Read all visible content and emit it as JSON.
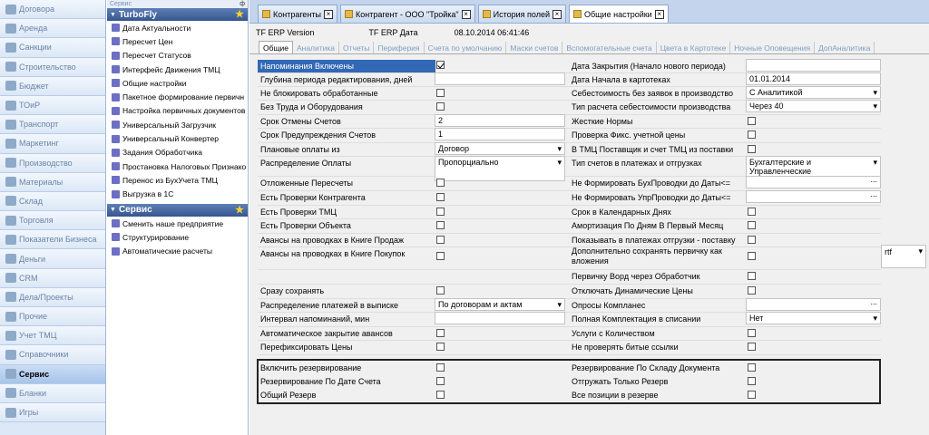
{
  "left_nav": {
    "items": [
      {
        "label": "Договора",
        "icon": "contract-icon",
        "active": false
      },
      {
        "label": "Аренда",
        "icon": "rent-icon",
        "active": false
      },
      {
        "label": "Санкции",
        "icon": "sanctions-icon",
        "active": false
      },
      {
        "label": "Строительство",
        "icon": "construction-icon",
        "active": false
      },
      {
        "label": "Бюджет",
        "icon": "budget-icon",
        "active": false
      },
      {
        "label": "ТОиР",
        "icon": "maintenance-icon",
        "active": false
      },
      {
        "label": "Транспорт",
        "icon": "transport-icon",
        "active": false
      },
      {
        "label": "Маркетинг",
        "icon": "marketing-icon",
        "active": false
      },
      {
        "label": "Производство",
        "icon": "production-icon",
        "active": false
      },
      {
        "label": "Материалы",
        "icon": "materials-icon",
        "active": false
      },
      {
        "label": "Склад",
        "icon": "warehouse-icon",
        "active": false
      },
      {
        "label": "Торговля",
        "icon": "trade-icon",
        "active": false
      },
      {
        "label": "Показатели Бизнеса",
        "icon": "business-indicators-icon",
        "active": false
      },
      {
        "label": "Деньги",
        "icon": "money-icon",
        "active": false
      },
      {
        "label": "CRM",
        "icon": "crm-icon",
        "active": false
      },
      {
        "label": "Дела/Проекты",
        "icon": "projects-icon",
        "active": false
      },
      {
        "label": "Прочие",
        "icon": "other-icon",
        "active": false
      },
      {
        "label": "Учет ТМЦ",
        "icon": "inventory-icon",
        "active": false
      },
      {
        "label": "Справочники",
        "icon": "references-icon",
        "active": false
      },
      {
        "label": "Сервис",
        "icon": "service-icon",
        "active": true
      },
      {
        "label": "Бланки",
        "icon": "forms-icon",
        "active": false
      },
      {
        "label": "Игры",
        "icon": "games-icon",
        "active": false
      }
    ]
  },
  "mid_panel": {
    "header": "Сервис",
    "pin_glyph": "ф",
    "group1": {
      "title": "TurboFly",
      "items": [
        "Дата Актуальности",
        "Пересчет Цен",
        "Пересчет Статусов",
        "Интерфейс Движения ТМЦ",
        "Общие настройки",
        "Пакетное формирование первичн",
        "Настройка первичных документов",
        "Универсальный Загрузчик",
        "Универсальный Конвертер",
        "Задания Обработчика",
        "Простановка Налоговых Признако",
        "Перенос из БухУчета ТМЦ",
        "Выгрузка в 1С"
      ]
    },
    "group2": {
      "title": "Сервис",
      "items": [
        "Сменить наше предприятие",
        "Структурирование",
        "Автоматические расчеты"
      ]
    }
  },
  "doc_tabs": [
    {
      "label": "Контрагенты",
      "active": false
    },
    {
      "label": "Контрагент - ООО \"Тройка\"",
      "active": false
    },
    {
      "label": "История полей",
      "active": false
    },
    {
      "label": "Общие настройки",
      "active": true
    }
  ],
  "info_bar": {
    "version": "TF ERP Version",
    "date_label": "TF ERP Дата",
    "date_value": "08.10.2014 06:41:46"
  },
  "settings_tabs": [
    {
      "label": "Общие",
      "active": true
    },
    {
      "label": "Аналитика",
      "active": false
    },
    {
      "label": "Отчеты",
      "active": false
    },
    {
      "label": "Периферия",
      "active": false
    },
    {
      "label": "Счета по умолчанию",
      "active": false
    },
    {
      "label": "Маски счетов",
      "active": false
    },
    {
      "label": "Вспомогательные счета",
      "active": false
    },
    {
      "label": "Цвета в Картотеке",
      "active": false
    },
    {
      "label": "Ночные Оповещения",
      "active": false
    },
    {
      "label": "ДопАналитика",
      "active": false
    }
  ],
  "left_settings": {
    "r1": {
      "label": "Напоминания Включены",
      "checked": true
    },
    "r2": {
      "label": "Глубина периода редактирования, дней",
      "value": ""
    },
    "r3": {
      "label": "Не блокировать обработанные",
      "checked": false
    },
    "r4": {
      "label": "Без Труда и Оборудования",
      "checked": false
    },
    "r5": {
      "label": "Срок Отмены Счетов",
      "value": "2"
    },
    "r6": {
      "label": "Срок Предупреждения Счетов",
      "value": "1"
    },
    "r7": {
      "label": "Плановые оплаты из",
      "value": "Договор"
    },
    "r8": {
      "label": "Распределение Оплаты",
      "value": "Пропорциально"
    },
    "r9": {
      "label": "Отложенные Пересчеты",
      "checked": false
    },
    "r10": {
      "label": "Есть Проверки Контрагента",
      "checked": false
    },
    "r11": {
      "label": "Есть Проверки ТМЦ",
      "checked": false
    },
    "r12": {
      "label": "Есть Проверки Объекта",
      "checked": false
    },
    "r13": {
      "label": "Авансы на проводках в Книге Продаж",
      "checked": false
    },
    "r14": {
      "label": "Авансы на проводках в Книге Покупок",
      "checked": false
    },
    "r15": {
      "label": "Сразу сохранять",
      "checked": false
    },
    "r16": {
      "label": "Распределение платежей в выписке",
      "value": "По договорам и актам"
    },
    "r17": {
      "label": "Интервал напоминаний, мин",
      "value": ""
    },
    "r18": {
      "label": "Автоматическое закрытие авансов",
      "checked": false
    },
    "r19": {
      "label": "Перефиксировать Цены",
      "checked": false
    },
    "r20": {
      "label": "Включить резервирование",
      "checked": false
    },
    "r21": {
      "label": "Резервирование По Дате Счета",
      "checked": false
    },
    "r22": {
      "label": "Общий Резерв",
      "checked": false
    }
  },
  "right_settings": {
    "r1": {
      "label": "Дата Закрытия (Начало нового периода)",
      "value": ""
    },
    "r2": {
      "label": "Дата Начала в картотеках",
      "value": "01.01.2014"
    },
    "r3": {
      "label": "Себестоимость без заявок в производство",
      "value": "С Аналитикой"
    },
    "r4": {
      "label": "Тип расчета себестоимости производства",
      "value": "Через 40"
    },
    "r5": {
      "label": "Жесткие Нормы",
      "checked": false
    },
    "r6": {
      "label": "Проверка Фикс. учетной цены",
      "checked": false
    },
    "r7": {
      "label": "В ТМЦ Поставщик и счет ТМЦ из поставки",
      "checked": false
    },
    "r8": {
      "label": "Тип счетов в платежах и отгрузках",
      "value_line1": "Бухгалтерские и",
      "value_line2": "Управленческие"
    },
    "r9": {
      "label": "Не Формировать БухПроводки до Даты<=",
      "value": ""
    },
    "r10": {
      "label": "Не Формировать УпрПроводки до Даты<=",
      "value": ""
    },
    "r11": {
      "label": "Срок в Календарных Днях",
      "checked": false
    },
    "r12": {
      "label": "Амортизация По Дням В  Первый Месяц",
      "checked": false
    },
    "r13": {
      "label": "Показывать в платежах отгрузки - поставку",
      "checked": false
    },
    "r14": {
      "label": "Дополнительно сохранять первичку как вложения",
      "checked": false,
      "format": "rtf"
    },
    "r15": {
      "label": "Первичку Ворд через Обработчик",
      "checked": false
    },
    "r16": {
      "label": "Отключать Динамические Цены",
      "checked": false
    },
    "r17": {
      "label": "Опросы Компланес",
      "value": ""
    },
    "r18": {
      "label": "Полная Комплектация в списании",
      "value": "Нет"
    },
    "r19": {
      "label": "Услуги с Количеством",
      "checked": false
    },
    "r20": {
      "label": "Не проверять битые ссылки",
      "checked": false
    },
    "r21": {
      "label": "Резервирование По Складу Документа",
      "checked": false
    },
    "r22": {
      "label": "Отгружать Только Резерв",
      "checked": false
    },
    "r23": {
      "label": "Все позиции в резерве",
      "checked": false
    }
  }
}
